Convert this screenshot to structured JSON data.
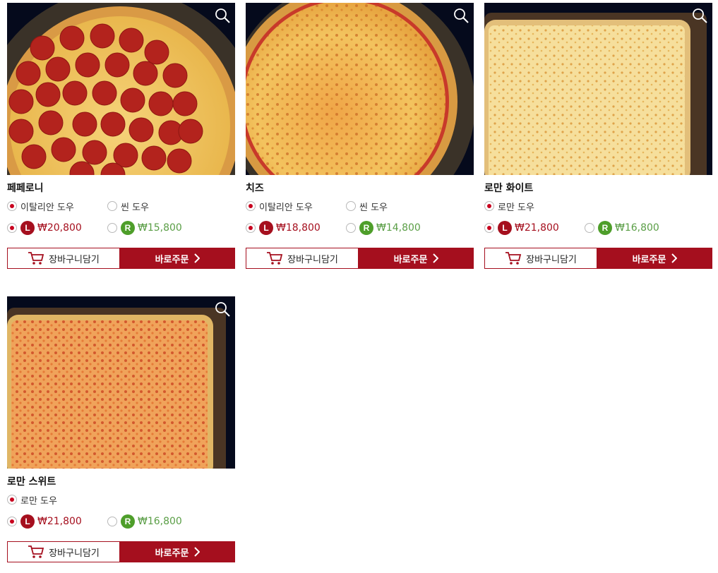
{
  "colors": {
    "brand": "#a50f1e",
    "regular": "#4e9e2a"
  },
  "products": [
    {
      "name": "페페로니",
      "doughs": [
        {
          "label": "이탈리안 도우",
          "selected": true
        },
        {
          "label": "씬 도우",
          "selected": false
        }
      ],
      "sizes": [
        {
          "badge": "L",
          "price": "₩20,800",
          "selected": true
        },
        {
          "badge": "R",
          "price": "₩15,800",
          "selected": false
        }
      ],
      "cart_label": "장바구니담기",
      "order_label": "바로주문",
      "image": "pepperoni-pizza",
      "zoom_icon": "zoom-icon"
    },
    {
      "name": "치즈",
      "doughs": [
        {
          "label": "이탈리안 도우",
          "selected": true
        },
        {
          "label": "씬 도우",
          "selected": false
        }
      ],
      "sizes": [
        {
          "badge": "L",
          "price": "₩18,800",
          "selected": true
        },
        {
          "badge": "R",
          "price": "₩14,800",
          "selected": false
        }
      ],
      "cart_label": "장바구니담기",
      "order_label": "바로주문",
      "image": "cheese-pizza",
      "zoom_icon": "zoom-icon"
    },
    {
      "name": "로만 화이트",
      "doughs": [
        {
          "label": "로만 도우",
          "selected": true
        }
      ],
      "sizes": [
        {
          "badge": "L",
          "price": "₩21,800",
          "selected": true
        },
        {
          "badge": "R",
          "price": "₩16,800",
          "selected": false
        }
      ],
      "cart_label": "장바구니담기",
      "order_label": "바로주문",
      "image": "roman-white-pizza",
      "zoom_icon": "zoom-icon"
    },
    {
      "name": "로만 스위트",
      "doughs": [
        {
          "label": "로만 도우",
          "selected": true
        }
      ],
      "sizes": [
        {
          "badge": "L",
          "price": "₩21,800",
          "selected": true
        },
        {
          "badge": "R",
          "price": "₩16,800",
          "selected": false
        }
      ],
      "cart_label": "장바구니담기",
      "order_label": "바로주문",
      "image": "roman-sweet-pizza",
      "zoom_icon": "zoom-icon"
    }
  ]
}
